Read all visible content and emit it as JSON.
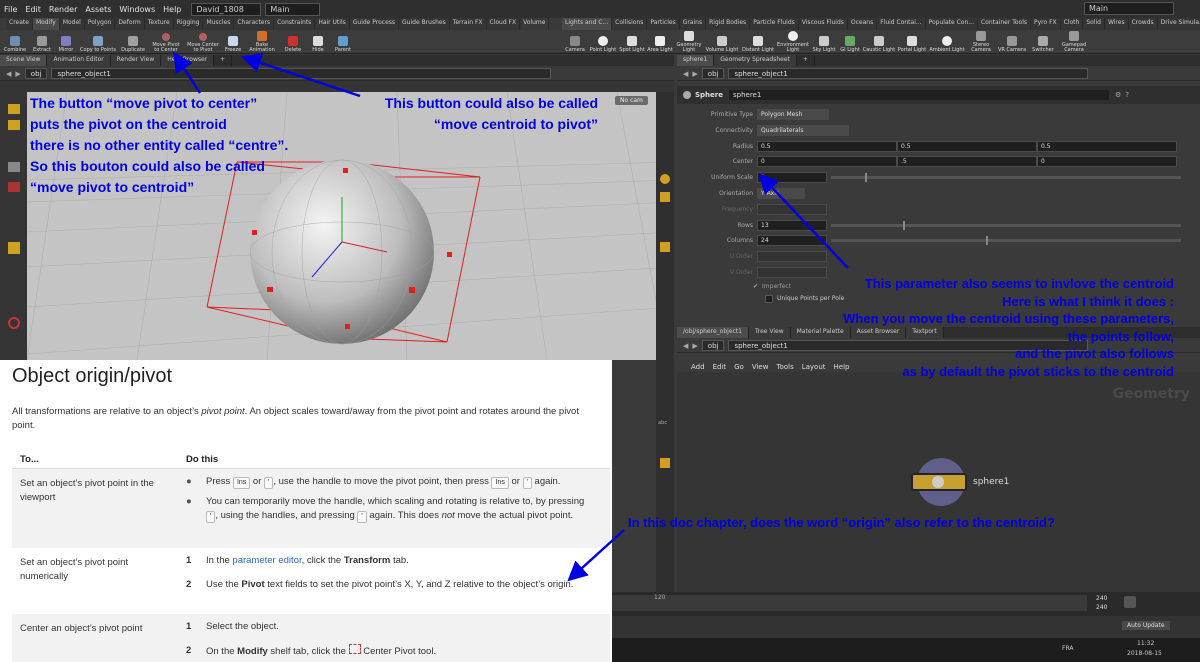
{
  "menu": {
    "items": [
      "File",
      "Edit",
      "Render",
      "Assets",
      "Windows",
      "Help"
    ],
    "desktop": "David_1808",
    "main": "Main",
    "main_right": "Main"
  },
  "shelf_tabs_left": [
    "Create",
    "Modify",
    "Model",
    "Polygon",
    "Deform",
    "Texture",
    "Rigging",
    "Muscles",
    "Characters",
    "Constraints",
    "Hair Utils",
    "Guide Process",
    "Guide Brushes",
    "Terrain FX",
    "Cloud FX",
    "Volume"
  ],
  "shelf_tabs_right": [
    "Lights and C...",
    "Collisions",
    "Particles",
    "Grains",
    "Rigid Bodies",
    "Particle Fluids",
    "Viscous Fluids",
    "Oceans",
    "Fluid Contai...",
    "Populate Con...",
    "Container Tools",
    "Pyro FX",
    "Cloth",
    "Solid",
    "Wires",
    "Crowds",
    "Drive Simula..."
  ],
  "tools_left": [
    {
      "l1": "Combine",
      "l2": ""
    },
    {
      "l1": "Extract",
      "l2": ""
    },
    {
      "l1": "Mirror",
      "l2": ""
    },
    {
      "l1": "Copy to Points",
      "l2": ""
    },
    {
      "l1": "Duplicate",
      "l2": ""
    },
    {
      "l1": "Move Pivot",
      "l2": "to Center"
    },
    {
      "l1": "Move Center",
      "l2": "to Pivot"
    },
    {
      "l1": "Freeze",
      "l2": ""
    },
    {
      "l1": "Bake",
      "l2": "Animation"
    },
    {
      "l1": "Delete",
      "l2": ""
    },
    {
      "l1": "Hide",
      "l2": ""
    },
    {
      "l1": "Parent",
      "l2": ""
    }
  ],
  "tools_right": [
    {
      "l1": "Camera",
      "l2": ""
    },
    {
      "l1": "Point Light",
      "l2": ""
    },
    {
      "l1": "Spot Light",
      "l2": ""
    },
    {
      "l1": "Area Light",
      "l2": ""
    },
    {
      "l1": "Geometry",
      "l2": "Light"
    },
    {
      "l1": "Volume Light",
      "l2": ""
    },
    {
      "l1": "Distant Light",
      "l2": ""
    },
    {
      "l1": "Environment",
      "l2": "Light"
    },
    {
      "l1": "Sky Light",
      "l2": ""
    },
    {
      "l1": "GI Light",
      "l2": ""
    },
    {
      "l1": "Caustic Light",
      "l2": ""
    },
    {
      "l1": "Portal Light",
      "l2": ""
    },
    {
      "l1": "Ambient Light",
      "l2": ""
    },
    {
      "l1": "Stereo",
      "l2": "Camera"
    },
    {
      "l1": "VR Camera",
      "l2": ""
    },
    {
      "l1": "Switcher",
      "l2": ""
    },
    {
      "l1": "Gamepad",
      "l2": "Camera"
    }
  ],
  "left_pane_tabs": [
    "Scene View",
    "Animation Editor",
    "Render View",
    "Help Browser"
  ],
  "left_path": {
    "obj": "obj",
    "node": "sphere_object1"
  },
  "viewport": {
    "camera": "No cam"
  },
  "right_pane_tabs": [
    "sphere1",
    "Geometry Spreadsheet"
  ],
  "right_path": {
    "obj": "obj",
    "node": "sphere_object1"
  },
  "params": {
    "node_type": "Sphere",
    "node_name": "sphere1",
    "primitive_type_label": "Primitive Type",
    "primitive_type": "Polygon Mesh",
    "connectivity_label": "Connectivity",
    "connectivity": "Quadrilaterals",
    "radius_label": "Radius",
    "radius": [
      "0.5",
      "0.5",
      "0.5"
    ],
    "center_label": "Center",
    "center": [
      "0",
      ".5",
      "0"
    ],
    "uniform_scale_label": "Uniform Scale",
    "uniform_scale": "1",
    "orientation_label": "Orientation",
    "orientation": "Y Axis",
    "frequency_label": "Frequency",
    "rows_label": "Rows",
    "rows": "13",
    "columns_label": "Columns",
    "columns": "24",
    "uorder_label": "U Order",
    "vorder_label": "V Order",
    "imperfect_label": "Imperfect",
    "unique_points_label": "Unique Points per Pole"
  },
  "network_tabs": [
    "/obj/sphere_object1",
    "Tree View",
    "Material Palette",
    "Asset Browser",
    "Textport"
  ],
  "network_path": {
    "obj": "obj",
    "node": "sphere_object1"
  },
  "network_menu": [
    "Add",
    "Edit",
    "Go",
    "View",
    "Tools",
    "Layout",
    "Help"
  ],
  "network": {
    "context": "Geometry",
    "node": "sphere1"
  },
  "timeline": {
    "tick": "120",
    "end1": "240",
    "end2": "240"
  },
  "status": {
    "auto_update": "Auto Update"
  },
  "taskbar": {
    "lang": "FRA",
    "time": "11:32",
    "date": "2018-08-15"
  },
  "doc": {
    "title": "Object origin/pivot",
    "intro_pre": "All transformations are relative to an object’s ",
    "intro_em": "pivot point",
    "intro_post": ". An object scales toward/away from the pivot point and rotates around the pivot point.",
    "col1": "To...",
    "col2": "Do this",
    "row1_task": "Set an object’s pivot point in the viewport",
    "row1_b1_a": "Press",
    "row1_b1_k1": "Ins",
    "row1_b1_or": "or",
    "row1_b1_k2": "'",
    "row1_b1_b": ", use the handle to move the pivot point, then press",
    "row1_b1_k3": "Ins",
    "row1_b1_or2": "or",
    "row1_b1_k4": "'",
    "row1_b1_c": "again.",
    "row1_b2_a": "You can temporarily move the handle, which scaling and rotating is relative to, by pressing",
    "row1_b2_k1": "'",
    "row1_b2_b": ", using the handles, and pressing",
    "row1_b2_k2": "'",
    "row1_b2_c": "again. This does",
    "row1_b2_not": "not",
    "row1_b2_d": "move the actual pivot point.",
    "row2_task": "Set an object’s pivot point numerically",
    "row2_n1": "1",
    "row2_s1_a": "In the",
    "row2_s1_link": "parameter editor",
    "row2_s1_b": ", click the",
    "row2_s1_bold": "Transform",
    "row2_s1_c": "tab.",
    "row2_n2": "2",
    "row2_s2_a": "Use the",
    "row2_s2_bold": "Pivot",
    "row2_s2_b": "text fields to set the pivot point’s X, Y, and Z relative to the object’s origin.",
    "row3_task": "Center an object’s pivot point",
    "row3_n1": "1",
    "row3_s1": "Select the object.",
    "row3_n2": "2",
    "row3_s2_a": "On the",
    "row3_s2_bold": "Modify",
    "row3_s2_b": "shelf tab, click the",
    "row3_s2_c": "Center Pivot tool."
  },
  "annotations": {
    "a1": [
      "The button “move pivot to center”",
      "puts the pivot on the centroid",
      "there is no other entity called “centre”.",
      "So this bouton could also be called",
      "“move pivot to centroid”"
    ],
    "a2": [
      "This button could also be called",
      "“move centroid to pivot”"
    ],
    "a3": [
      "This parameter also seems to invlove the centroid",
      "Here is what I think it does :",
      "When you move the centroid using these parameters,",
      "the points follow,",
      "and the pivot  also follows",
      "as by default the pivot sticks to the centroid"
    ],
    "a4": "In this doc chapter, does the word “origin” also refer to the centroid?",
    "color": "#0000e0"
  }
}
